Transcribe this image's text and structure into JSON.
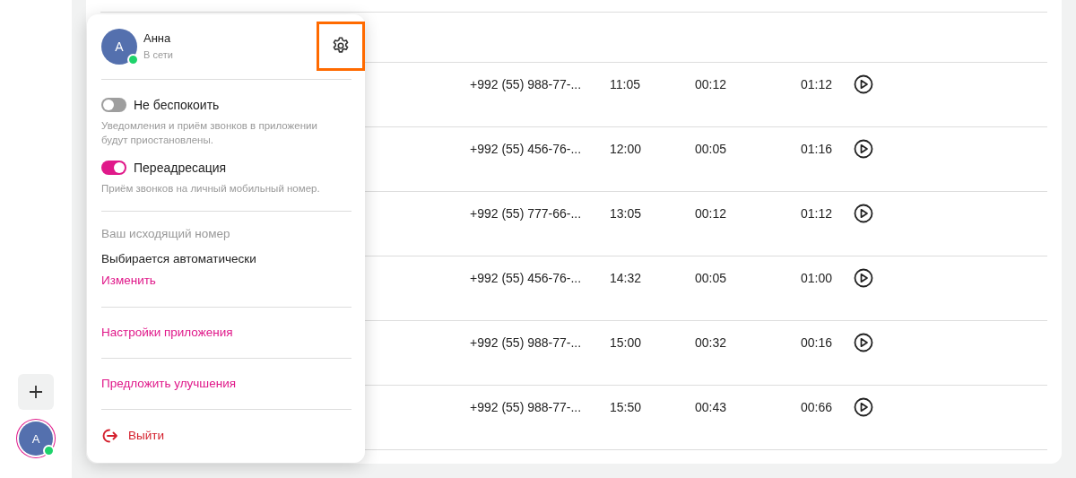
{
  "sidebar": {
    "avatar": {
      "initial": "А",
      "online": true
    }
  },
  "table": {
    "rows": [
      {
        "phone": "+992 (55) 988-77-...",
        "column_3": "11:05",
        "column_4": "00:12",
        "column_5": "01:12"
      },
      {
        "phone": "+992 (55) 456-76-...",
        "column_3": "12:00",
        "column_4": "00:05",
        "column_5": "01:16"
      },
      {
        "phone": "+992 (55) 777-66-...",
        "column_3": "13:05",
        "column_4": "00:12",
        "column_5": "01:12"
      },
      {
        "phone": "+992 (55) 456-76-...",
        "column_3": "14:32",
        "column_4": "00:05",
        "column_5": "01:00"
      },
      {
        "phone": "+992 (55) 988-77-...",
        "column_3": "15:00",
        "column_4": "00:32",
        "column_5": "00:16"
      },
      {
        "phone": "+992 (55) 988-77-...",
        "column_3": "15:50",
        "column_4": "00:43",
        "column_5": "00:66"
      }
    ]
  },
  "popup": {
    "user": {
      "initial": "А",
      "name": "Анна",
      "status": "В сети",
      "online": true
    },
    "settings_button": {
      "highlighted": true
    },
    "toggles": [
      {
        "label": "Не беспокоить",
        "description": "Уведомления и приём звонков в приложении будут приостановлены.",
        "on": false
      },
      {
        "label": "Переадресация",
        "description": "Приём звонков на личный мобильный номер.",
        "on": true
      }
    ],
    "outgoing": {
      "title": "Ваш исходящий номер",
      "value": "Выбирается автоматически",
      "link": "Изменить"
    },
    "links": [
      "Настройки приложения",
      "Предложить улучшения"
    ],
    "logout": {
      "label": "Выйти"
    }
  }
}
